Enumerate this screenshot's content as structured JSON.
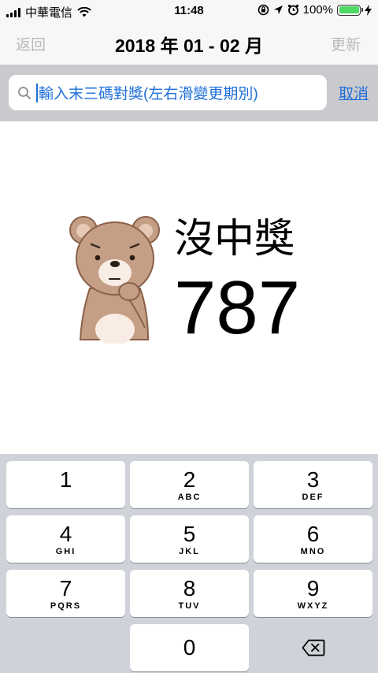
{
  "status_bar": {
    "carrier": "中華電信",
    "time": "11:48",
    "battery": "100%",
    "battery_level": 1.0
  },
  "nav": {
    "back_label": "返回",
    "title": "2018 年 01 - 02 月",
    "update_label": "更新"
  },
  "search": {
    "placeholder": "輸入末三碼對獎(左右滑變更期別)",
    "cancel_label": "取消"
  },
  "result": {
    "status": "沒中獎",
    "number": "787"
  },
  "keypad": {
    "keys": [
      {
        "digit": "1",
        "letters": ""
      },
      {
        "digit": "2",
        "letters": "ABC"
      },
      {
        "digit": "3",
        "letters": "DEF"
      },
      {
        "digit": "4",
        "letters": "GHI"
      },
      {
        "digit": "5",
        "letters": "JKL"
      },
      {
        "digit": "6",
        "letters": "MNO"
      },
      {
        "digit": "7",
        "letters": "PQRS"
      },
      {
        "digit": "8",
        "letters": "TUV"
      },
      {
        "digit": "9",
        "letters": "WXYZ"
      },
      {
        "digit": "0",
        "letters": ""
      }
    ],
    "delete_icon": "backspace-icon"
  },
  "colors": {
    "accent": "#1e6fd9",
    "disabled": "#b8b8b8",
    "battery": "#4cd964"
  }
}
